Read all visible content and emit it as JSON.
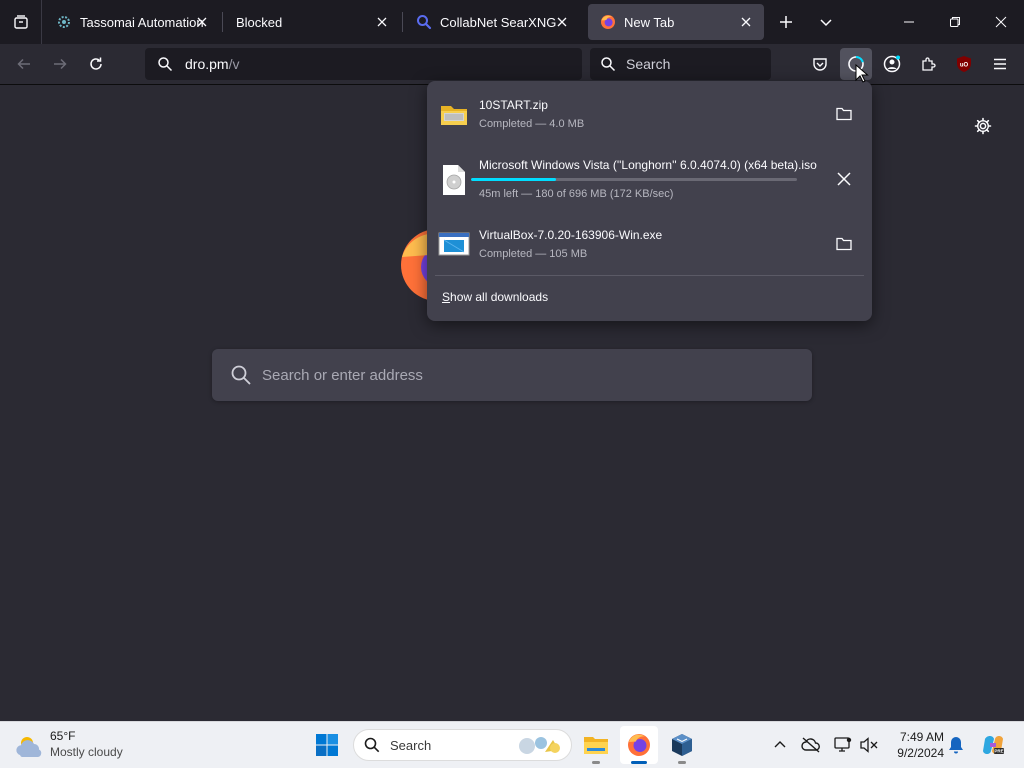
{
  "tabs": [
    {
      "title": "Tassomai Automation",
      "favicon": "tassomai-favicon",
      "active": false
    },
    {
      "title": "Blocked",
      "favicon": "none",
      "active": false
    },
    {
      "title": "CollabNet SearXNG",
      "favicon": "searxng-magnifier-icon",
      "active": false
    },
    {
      "title": "New Tab",
      "favicon": "firefox-icon",
      "active": true
    }
  ],
  "toolbar": {
    "url_host": "dro.pm",
    "url_path": "/v",
    "search_placeholder": "Search"
  },
  "newtab": {
    "search_placeholder": "Search or enter address"
  },
  "downloads": {
    "items": [
      {
        "name": "10START.zip",
        "status": "Completed — 4.0 MB",
        "icon": "zip-file-icon",
        "action": "open-folder",
        "progress": 1.0
      },
      {
        "name": "Microsoft Windows Vista (''Longhorn'' 6.0.4074.0) (x64 beta).iso",
        "status": "45m left — 180 of 696 MB (172 KB/sec)",
        "icon": "iso-file-icon",
        "action": "cancel",
        "progress": 0.26
      },
      {
        "name": "VirtualBox-7.0.20-163906-Win.exe",
        "status": "Completed — 105 MB",
        "icon": "exe-file-icon",
        "action": "open-folder",
        "progress": 1.0
      }
    ],
    "show_all_prefix": "S",
    "show_all_rest": "how all downloads"
  },
  "taskbar": {
    "weather_temp": "65°F",
    "weather_desc": "Mostly cloudy",
    "search_placeholder": "Search",
    "time": "7:49 AM",
    "date": "9/2/2024"
  },
  "colors": {
    "accent": "#00ddff",
    "browser_bg": "#2b2a33",
    "panel_bg": "#42414d",
    "tabstrip_bg": "#1c1b22",
    "taskbar_bg": "#eef0f4"
  }
}
